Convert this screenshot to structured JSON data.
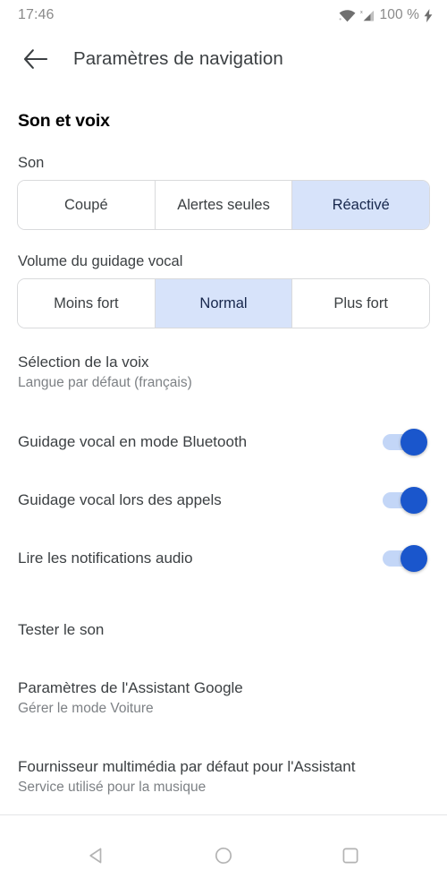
{
  "statusbar": {
    "time": "17:46",
    "battery": "100 %",
    "icons": [
      "wifi-icon",
      "cellular-no-sim-icon",
      "charging-bolt-icon"
    ]
  },
  "appbar": {
    "back_icon": "arrow-left-icon",
    "title": "Paramètres de navigation"
  },
  "content": {
    "section_title": "Son et voix",
    "sound": {
      "label": "Son",
      "options": [
        "Coupé",
        "Alertes seules",
        "Réactivé"
      ],
      "selected": "Réactivé"
    },
    "volume": {
      "label": "Volume du guidage vocal",
      "options": [
        "Moins fort",
        "Normal",
        "Plus fort"
      ],
      "selected": "Normal"
    },
    "voice_selection": {
      "title": "Sélection de la voix",
      "subtitle": "Langue par défaut (français)"
    },
    "toggles": [
      {
        "title": "Guidage vocal en mode Bluetooth",
        "state": "on"
      },
      {
        "title": "Guidage vocal lors des appels",
        "state": "on"
      },
      {
        "title": "Lire les notifications audio",
        "state": "on"
      }
    ],
    "test_sound": {
      "title": "Tester le son"
    },
    "assistant_settings": {
      "title": "Paramètres de l'Assistant Google",
      "subtitle": "Gérer le mode Voiture"
    },
    "media_provider": {
      "title": "Fournisseur multimédia par défaut pour l'Assistant",
      "subtitle": "Service utilisé pour la musique"
    }
  },
  "navbar": {
    "back": "back-triangle-icon",
    "home": "home-circle-icon",
    "recents": "recents-square-icon"
  },
  "colors": {
    "accent": "#1a56cc",
    "selected_segment_bg": "#d7e3fa",
    "selected_segment_text": "#17274c",
    "track": "#c3d6f7",
    "primary_text": "#3c4043",
    "secondary_text": "#7d8185"
  }
}
